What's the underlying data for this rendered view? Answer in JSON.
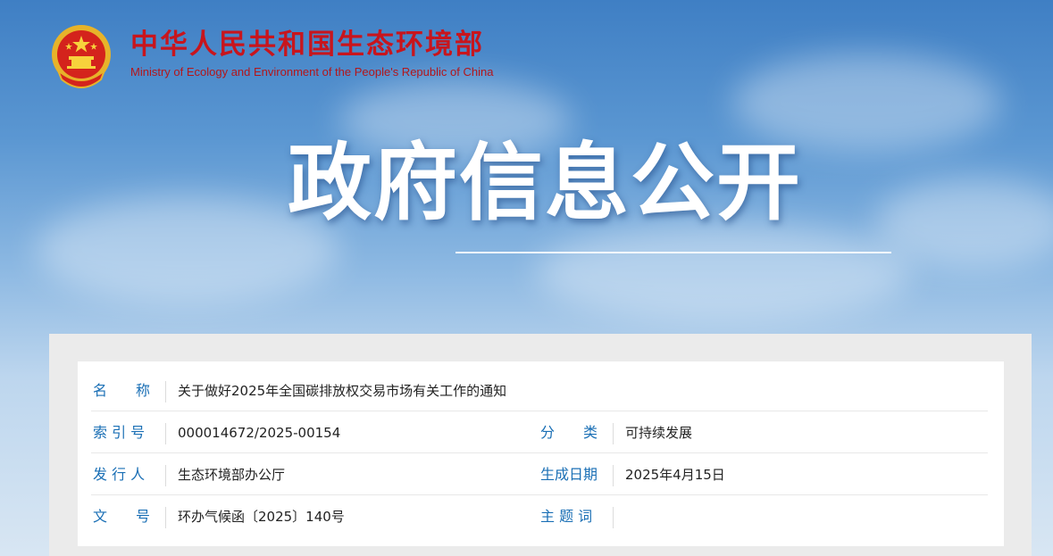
{
  "header": {
    "title_cn": "中华人民共和国生态环境部",
    "title_en": "Ministry of Ecology and Environment of the People's Republic of China",
    "emblem_icon": "national-emblem-icon"
  },
  "banner": {
    "title": "政府信息公开"
  },
  "info": {
    "name_label": "名　　称",
    "name_value": "关于做好2025年全国碳排放权交易市场有关工作的通知",
    "index_label": "索 引 号",
    "index_value": "000014672/2025-00154",
    "category_label": "分　　类",
    "category_value": "可持续发展",
    "issuer_label": "发 行 人",
    "issuer_value": "生态环境部办公厅",
    "date_label": "生成日期",
    "date_value": "2025年4月15日",
    "doc_no_label": "文　　号",
    "doc_no_value": "环办气候函〔2025〕140号",
    "keywords_label": "主 题 词",
    "keywords_value": ""
  },
  "colors": {
    "brand_red": "#c8151d",
    "label_blue": "#1a6fb5",
    "text": "#222222"
  }
}
